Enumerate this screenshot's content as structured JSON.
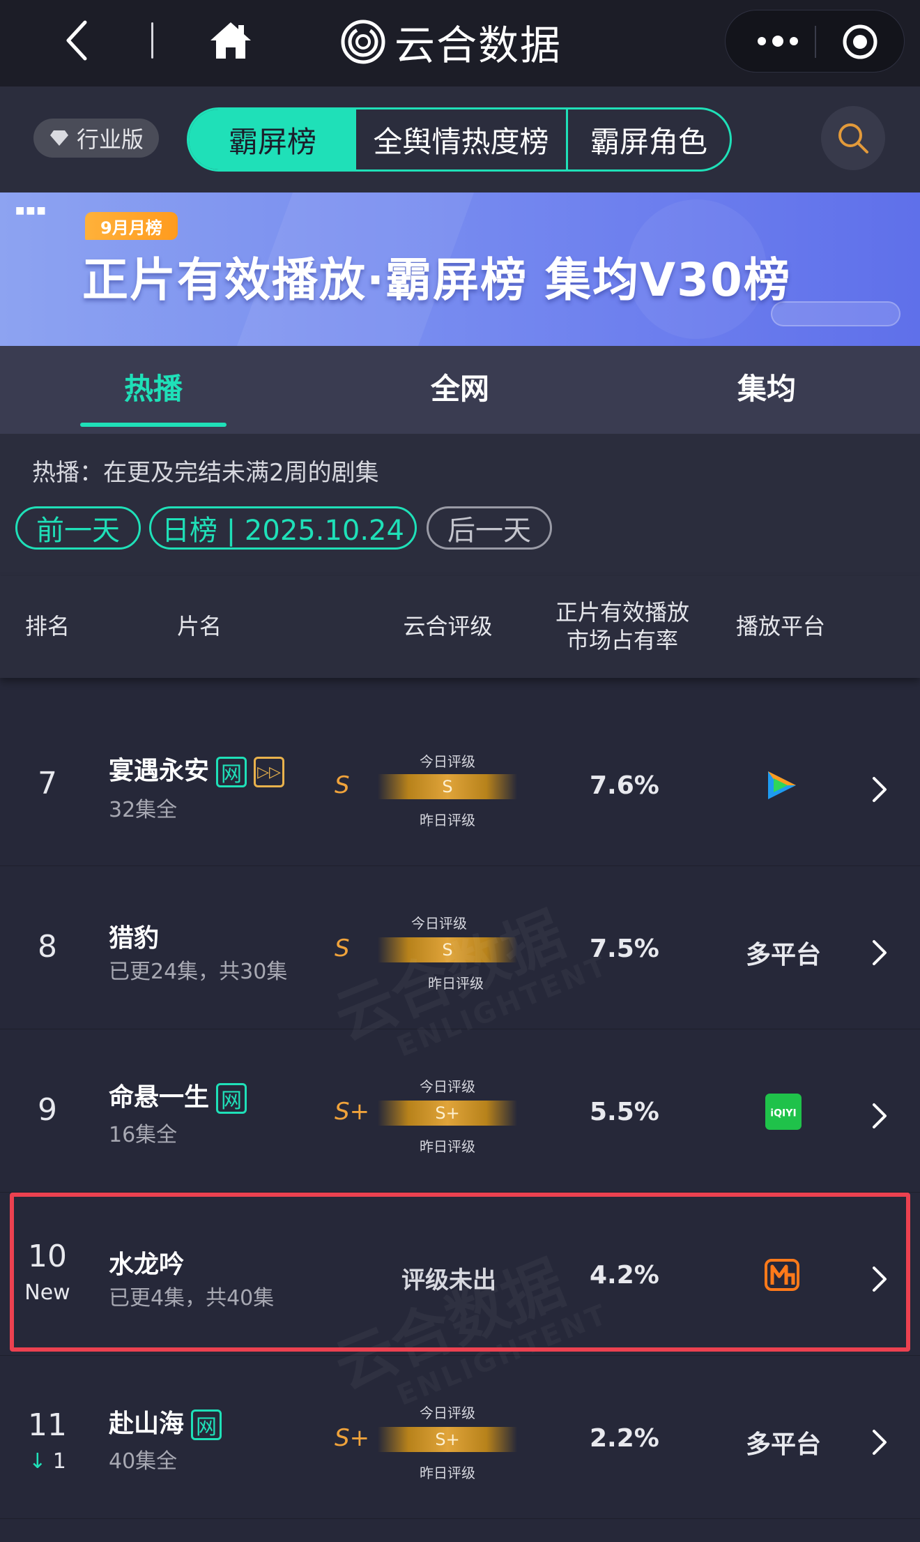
{
  "topbar": {
    "title": "云合数据",
    "icons": [
      "back-icon",
      "home-icon",
      "logo-icon",
      "more-icon",
      "target-icon"
    ]
  },
  "filter": {
    "edition": "行业版",
    "tabs": [
      "霸屏榜",
      "全舆情热度榜",
      "霸屏角色"
    ],
    "active_tab": "霸屏榜"
  },
  "banner": {
    "month_tag": "9月月榜",
    "title": "正片有效播放·霸屏榜 集均V30榜"
  },
  "subtabs": {
    "items": [
      "热播",
      "全网",
      "集均"
    ],
    "active": "热播"
  },
  "description": "热播：在更及完结未满2周的剧集",
  "date_nav": {
    "prev": "前一天",
    "current": "日榜 | 2025.10.24",
    "next": "后一天"
  },
  "table": {
    "headers": {
      "rank": "排名",
      "title": "片名",
      "grade": "云合评级",
      "share_line1": "正片有效播放",
      "share_line2": "市场占有率",
      "platform": "播放平台"
    },
    "gauge_labels": {
      "today": "今日评级",
      "yesterday": "昨日评级"
    },
    "rows": [
      {
        "rank": "7",
        "rank_sub": "",
        "title": "宴遇永安",
        "tags": [
          "网",
          "▷▷"
        ],
        "episodes": "32集全",
        "grade": "S",
        "today_grade": "S",
        "share": "7.6%",
        "platform": "",
        "platform_icon": "tencent-video-icon"
      },
      {
        "rank": "8",
        "rank_sub": "",
        "title": "猎豹",
        "tags": [],
        "episodes": "已更24集，共30集",
        "grade": "S",
        "today_grade": "S",
        "share": "7.5%",
        "platform": "多平台",
        "platform_icon": ""
      },
      {
        "rank": "9",
        "rank_sub": "",
        "title": "命悬一生",
        "tags": [
          "网"
        ],
        "episodes": "16集全",
        "grade": "S+",
        "today_grade": "S+",
        "share": "5.5%",
        "platform": "",
        "platform_icon": "iqiyi-icon"
      },
      {
        "rank": "10",
        "rank_sub": "New",
        "title": "水龙吟",
        "tags": [],
        "episodes": "已更4集，共40集",
        "grade": "",
        "grade_status": "评级未出",
        "share": "4.2%",
        "platform": "",
        "platform_icon": "mango-tv-icon"
      },
      {
        "rank": "11",
        "rank_sub": "1",
        "rank_change": "down",
        "title": "赴山海",
        "tags": [
          "网"
        ],
        "episodes": "40集全",
        "grade": "S+",
        "today_grade": "S+",
        "share": "2.2%",
        "platform": "多平台",
        "platform_icon": ""
      }
    ]
  },
  "iqiyi_text": "iQIYI",
  "watermark": {
    "cn": "云合数据",
    "en": "ENLIGHTENT"
  },
  "colors": {
    "accent": "#1fe0b8",
    "grade": "#f0a33b",
    "highlight": "#ec4150",
    "background": "#262839",
    "banner": "#7a8ff0"
  }
}
